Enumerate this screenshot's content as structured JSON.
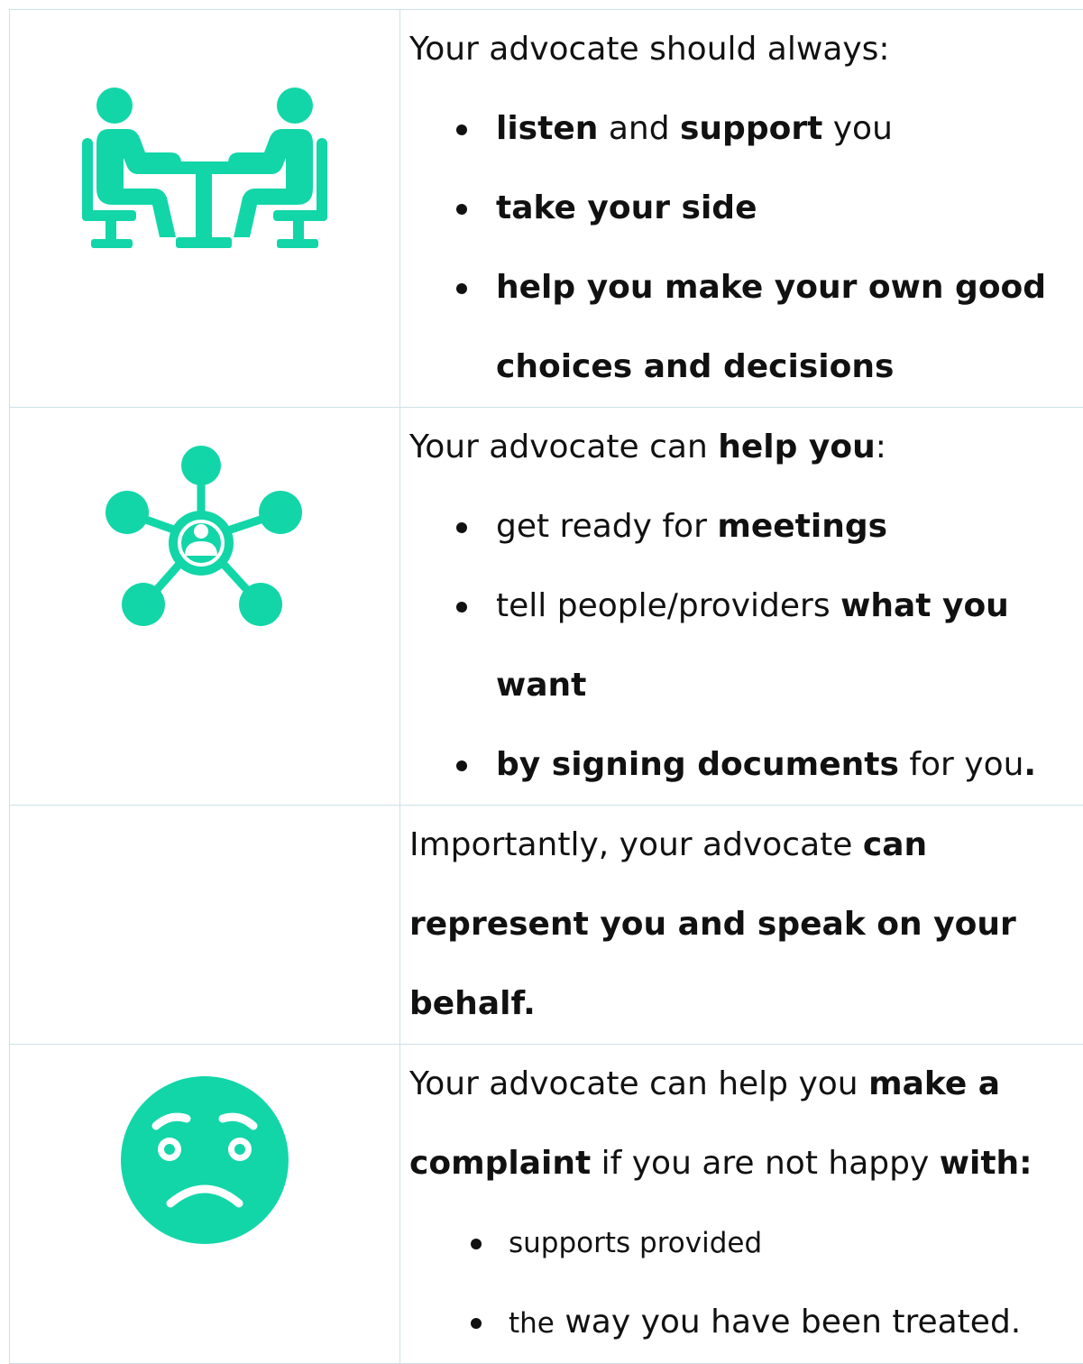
{
  "colors": {
    "accent": "#12d6a8",
    "border": "#cfdfe8"
  },
  "rows": [
    {
      "icon": "meeting-table-icon",
      "intro": "Your advocate should always:",
      "items": [
        {
          "b1": "listen",
          "t1": " and ",
          "b2": "support",
          "t2": " you"
        },
        {
          "b1": "take your side"
        },
        {
          "b1": "help you make your own good choices and decisions"
        }
      ]
    },
    {
      "icon": "network-person-icon",
      "intro_a": "Your advocate can ",
      "intro_b": "help you",
      "intro_c": ":",
      "items": [
        {
          "t1": "get ready for ",
          "b1": "meetings"
        },
        {
          "t1": "tell people/providers ",
          "b1": "what you want"
        },
        {
          "b1": "by signing documents",
          "t1": " for you",
          "b2": "."
        }
      ]
    },
    {
      "intro_a": "Importantly, your advocate ",
      "intro_b": "can represent you and speak on your behalf."
    },
    {
      "icon": "worried-face-icon",
      "intro_a": "Your advocate can help you ",
      "intro_b": "make a complaint",
      "intro_c": " if you are not happy ",
      "intro_d": "with:",
      "items": [
        {
          "t1": "supports provided"
        },
        {
          "t1": "the",
          "t2": " way you have been treated."
        }
      ]
    }
  ]
}
